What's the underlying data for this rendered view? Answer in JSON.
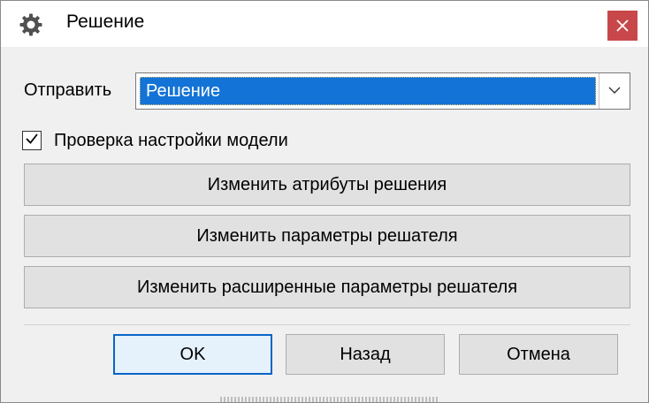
{
  "window": {
    "title": "Решение",
    "icon": "gear-icon",
    "close_icon": "close-icon",
    "close_color": "#c8474a"
  },
  "send": {
    "label": "Отправить",
    "selected": "Решение",
    "highlight_color": "#1473d6"
  },
  "model_check": {
    "label": "Проверка настройки модели",
    "checked": true
  },
  "actions": {
    "edit_attributes": "Изменить атрибуты решения",
    "edit_solver_params": "Изменить параметры решателя",
    "edit_advanced_params": "Изменить расширенные параметры решателя"
  },
  "footer": {
    "ok": "OK",
    "back": "Назад",
    "cancel": "Отмена",
    "focus_color": "#0a64c8"
  }
}
